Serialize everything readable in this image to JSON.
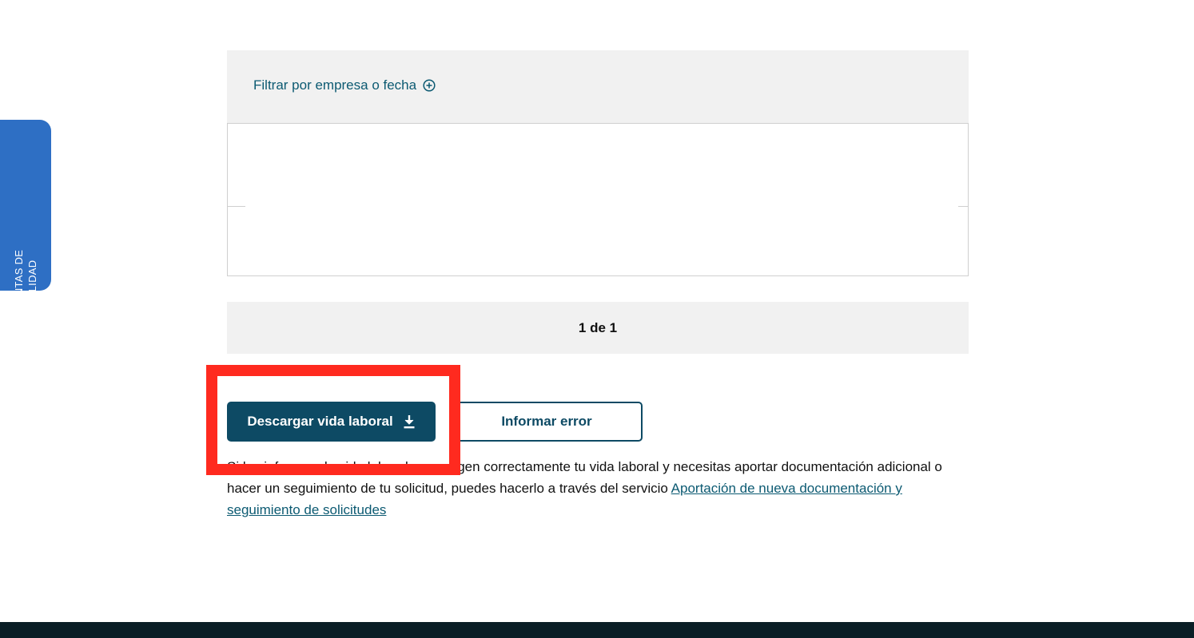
{
  "accessibility_tab": {
    "line1": "HERRAMIENTAS DE",
    "line2": "ACCESIBILIDAD",
    "icon": "accessibility-icon",
    "color": "#2e6fc4"
  },
  "filter": {
    "label": "Filtrar por empresa o fecha",
    "icon": "plus-circle-icon"
  },
  "pagination": {
    "label": "1 de 1"
  },
  "actions": {
    "download_label": "Descargar vida laboral",
    "download_icon": "download-icon",
    "report_label": "Informar error",
    "primary_color": "#0d4a64"
  },
  "info": {
    "text": "Si los informes de vida laboral no recogen correctamente tu vida laboral y necesitas aportar documentación adicional o hacer un seguimiento de tu solicitud, puedes hacerlo a través del servicio ",
    "link_label": "Aportación de nueva documentación y seguimiento de solicitudes"
  },
  "highlight": {
    "color": "#ff2a1f"
  }
}
